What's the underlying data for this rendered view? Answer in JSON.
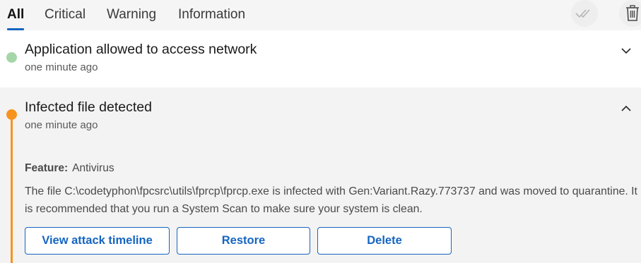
{
  "tabs": {
    "all": "All",
    "critical": "Critical",
    "warning": "Warning",
    "information": "Information"
  },
  "icons": {
    "mark_all_read": "double-check-icon",
    "delete_all": "trash-icon"
  },
  "colors": {
    "accent": "#1565c0",
    "info_dot": "#a5d6a7",
    "warning_dot": "#f7941d"
  },
  "notifications": [
    {
      "title": "Application allowed to access network",
      "time": "one minute ago",
      "expanded": false
    },
    {
      "title": "Infected file detected",
      "time": "one minute ago",
      "expanded": true,
      "feature_label": "Feature:",
      "feature_value": "Antivirus",
      "description": "The file C:\\codetyphon\\fpcsrc\\utils\\fprcp\\fprcp.exe is infected with Gen:Variant.Razy.773737 and was moved to quarantine. It is recommended that you run a System Scan to make sure your system is clean.",
      "buttons": {
        "timeline": "View attack timeline",
        "restore": "Restore",
        "delete": "Delete"
      }
    }
  ]
}
